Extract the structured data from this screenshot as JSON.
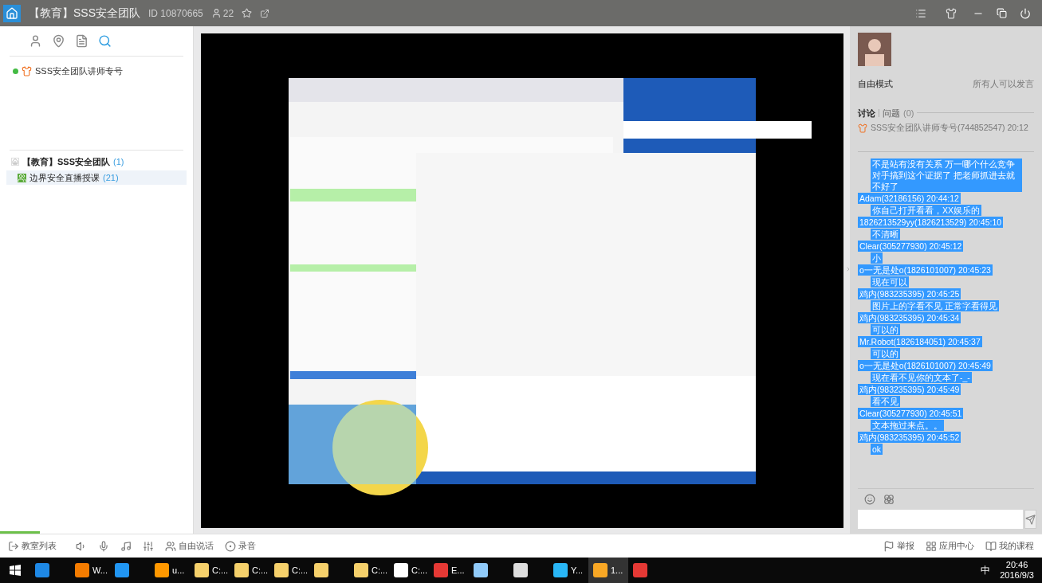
{
  "title_bar": {
    "title": "【教育】SSS安全团队",
    "id": "ID 10870665",
    "members": "22"
  },
  "sidebar": {
    "tabs": [
      {
        "kind": "user",
        "selected": false
      },
      {
        "kind": "pin",
        "selected": false
      },
      {
        "kind": "doc",
        "selected": false
      },
      {
        "kind": "search",
        "selected": true
      }
    ],
    "teacher": {
      "name": "SSS安全团队讲师专号",
      "online": true
    },
    "channel": {
      "name": "【教育】SSS安全团队",
      "count": "(1)"
    },
    "rooms": [
      {
        "name": "边界安全直播授课",
        "count": "(21)",
        "selected": true
      }
    ]
  },
  "chat_panel": {
    "mode": "自由模式",
    "permission": "所有人可以发言",
    "tabs": [
      {
        "label": "讨论",
        "selected": true
      },
      {
        "label": "问题",
        "count": "(0)",
        "selected": false
      }
    ],
    "pinned": "SSS安全团队讲师专号(744852547) 20:12",
    "messages": [
      {
        "kind": "body",
        "text": "不是站有没有关系 万一哪个什么竞争对手搞到这个证据了 把老师抓进去就不好了"
      },
      {
        "kind": "header",
        "text": "Adam(32186156) 20:44:12"
      },
      {
        "kind": "body",
        "text": "你自己打开看看，XX娱乐的"
      },
      {
        "kind": "header",
        "text": "1826213529yy(1826213529) 20:45:10"
      },
      {
        "kind": "body",
        "text": "不清晰"
      },
      {
        "kind": "header",
        "text": "Clear(305277930) 20:45:12"
      },
      {
        "kind": "body",
        "text": "小"
      },
      {
        "kind": "header",
        "text": "o一无是处o(1826101007) 20:45:23"
      },
      {
        "kind": "body",
        "text": "现在可以"
      },
      {
        "kind": "header",
        "text": "鸡内(983235395) 20:45:25"
      },
      {
        "kind": "body",
        "text": "图片上的字看不见 正常字看得见"
      },
      {
        "kind": "header",
        "text": "鸡内(983235395) 20:45:34"
      },
      {
        "kind": "body",
        "text": "可以的"
      },
      {
        "kind": "header",
        "text": "Mr.Robot(1826184051) 20:45:37"
      },
      {
        "kind": "body",
        "text": "可以的"
      },
      {
        "kind": "header",
        "text": "o一无是处o(1826101007) 20:45:49"
      },
      {
        "kind": "body",
        "text": "现在看不见你的文本了-_-"
      },
      {
        "kind": "header",
        "text": "鸡内(983235395) 20:45:49"
      },
      {
        "kind": "body",
        "text": "看不见"
      },
      {
        "kind": "header",
        "text": "Clear(305277930) 20:45:51"
      },
      {
        "kind": "body",
        "text": "文本拖过来点。。"
      },
      {
        "kind": "header",
        "text": "鸡内(983235395) 20:45:52"
      },
      {
        "kind": "body",
        "text": "ok"
      }
    ]
  },
  "toolbar": {
    "left": [
      {
        "kind": "exit",
        "label": "教室列表"
      },
      {
        "kind": "speaker"
      },
      {
        "kind": "mic"
      },
      {
        "kind": "music"
      },
      {
        "kind": "mixer"
      },
      {
        "kind": "talk",
        "label": "自由说话"
      },
      {
        "kind": "record",
        "label": "录音"
      }
    ],
    "right": [
      {
        "kind": "report",
        "label": "举报"
      },
      {
        "kind": "apps",
        "label": "应用中心"
      },
      {
        "kind": "courses",
        "label": "我的课程"
      }
    ]
  },
  "taskbar": {
    "apps": [
      {
        "kind": "edge",
        "selected": false
      },
      {
        "kind": "firefox",
        "label": "W...",
        "selected": false
      },
      {
        "kind": "vm",
        "selected": false
      },
      {
        "kind": "search",
        "label": "u...",
        "selected": false
      },
      {
        "kind": "folder",
        "label": "C:...",
        "selected": false
      },
      {
        "kind": "folder",
        "label": "C:...",
        "selected": false
      },
      {
        "kind": "folder",
        "label": "C:...",
        "selected": false
      },
      {
        "kind": "folder",
        "selected": false
      },
      {
        "kind": "folder",
        "label": "C:...",
        "selected": false
      },
      {
        "kind": "archiver",
        "label": "C:...",
        "selected": false
      },
      {
        "kind": "eraser",
        "label": "E...",
        "selected": false
      },
      {
        "kind": "notepad",
        "selected": false
      },
      {
        "kind": "audio",
        "selected": false
      },
      {
        "kind": "ie",
        "label": "Y...",
        "selected": false
      },
      {
        "kind": "mascot",
        "label": "1...",
        "selected": true
      },
      {
        "kind": "news",
        "selected": false
      }
    ],
    "ime": "中",
    "time": "20:46",
    "date": "2016/9/3"
  }
}
